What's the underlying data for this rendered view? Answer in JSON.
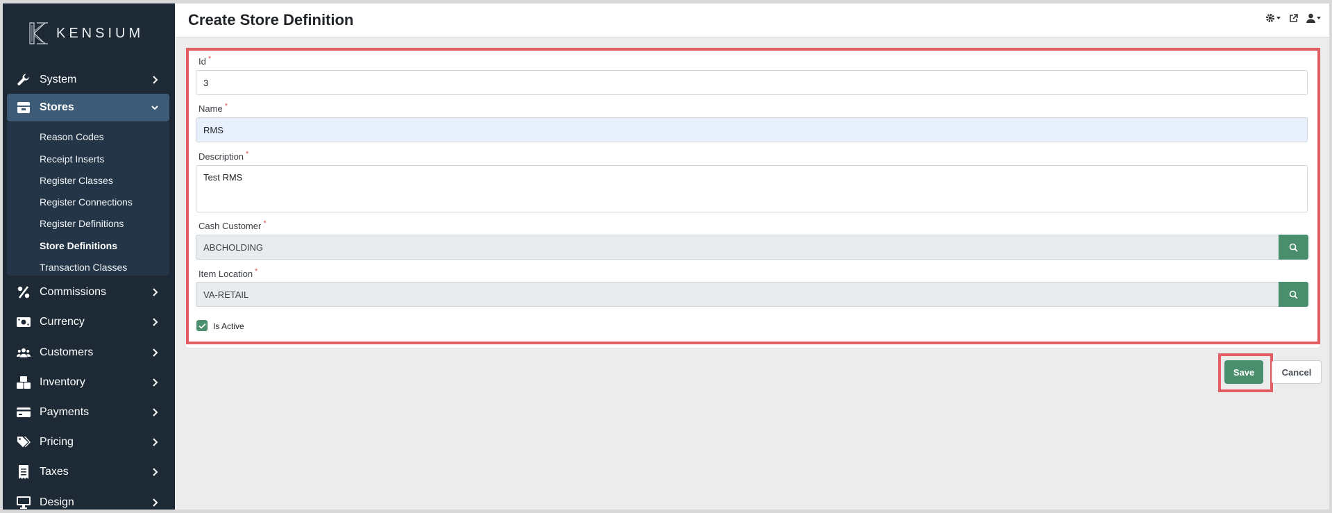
{
  "app": {
    "logo_text": "KENSIUM"
  },
  "header": {
    "title": "Create Store Definition"
  },
  "sidebar": {
    "items": [
      {
        "label": "System",
        "icon": "wrench-icon"
      },
      {
        "label": "Stores",
        "icon": "store-icon"
      },
      {
        "label": "Commissions",
        "icon": "percent-icon"
      },
      {
        "label": "Currency",
        "icon": "money-icon"
      },
      {
        "label": "Customers",
        "icon": "users-icon"
      },
      {
        "label": "Inventory",
        "icon": "boxes-icon"
      },
      {
        "label": "Payments",
        "icon": "credit-card-icon"
      },
      {
        "label": "Pricing",
        "icon": "tags-icon"
      },
      {
        "label": "Taxes",
        "icon": "receipt-icon"
      },
      {
        "label": "Design",
        "icon": "desktop-icon"
      }
    ],
    "stores_submenu": [
      "Reason Codes",
      "Receipt Inserts",
      "Register Classes",
      "Register Connections",
      "Register Definitions",
      "Store Definitions",
      "Transaction Classes"
    ]
  },
  "form": {
    "id": {
      "label": "Id",
      "value": "3"
    },
    "name": {
      "label": "Name",
      "value": "RMS"
    },
    "description": {
      "label": "Description",
      "value": "Test RMS"
    },
    "cash_customer": {
      "label": "Cash Customer",
      "value": "ABCHOLDING"
    },
    "item_location": {
      "label": "Item Location",
      "value": "VA-RETAIL"
    },
    "is_active": {
      "label": "Is Active",
      "checked": true
    },
    "required_mark": "*"
  },
  "actions": {
    "save_label": "Save",
    "cancel_label": "Cancel"
  },
  "colors": {
    "accent": "#4a8e6d",
    "sidebar": "#1d2a36",
    "highlight": "#e35f64"
  }
}
